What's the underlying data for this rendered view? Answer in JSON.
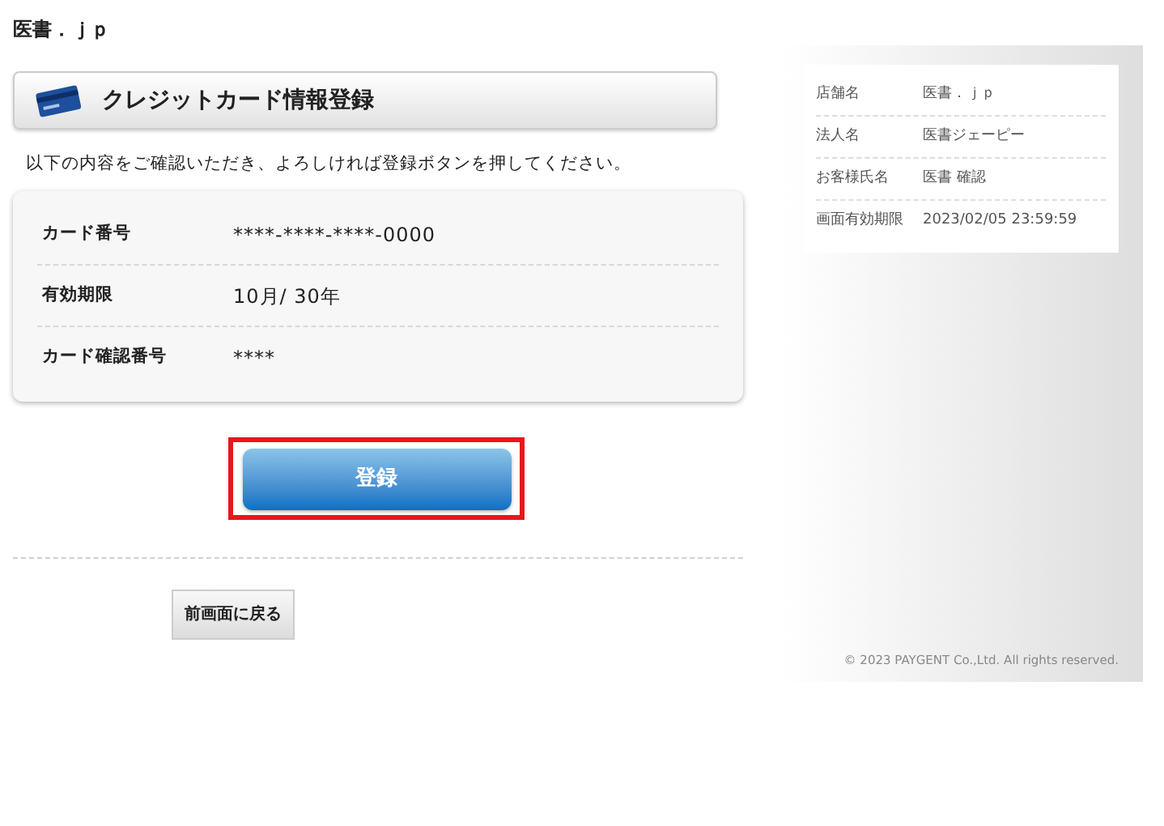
{
  "site_title": "医書．ｊｐ",
  "section_header": {
    "title": "クレジットカード情報登録"
  },
  "instruction": "以下の内容をご確認いただき、よろしければ登録ボタンを押してください。",
  "card_details": [
    {
      "label": "カード番号",
      "value": "****-****-****-0000"
    },
    {
      "label": "有効期限",
      "value": "10月/ 30年"
    },
    {
      "label": "カード確認番号",
      "value": "****"
    }
  ],
  "register_button": {
    "label": "登録",
    "highlighted": true
  },
  "back_button": {
    "label": "前画面に戻る"
  },
  "side_info": [
    {
      "label": "店舗名",
      "value": "医書．ｊｐ"
    },
    {
      "label": "法人名",
      "value": "医書ジェーピー"
    },
    {
      "label": "お客様氏名",
      "value": "医書 確認"
    },
    {
      "label": "画面有効期限",
      "value": "2023/02/05 23:59:59"
    }
  ],
  "copyright": "© 2023 PAYGENT Co.,Ltd. All rights reserved."
}
